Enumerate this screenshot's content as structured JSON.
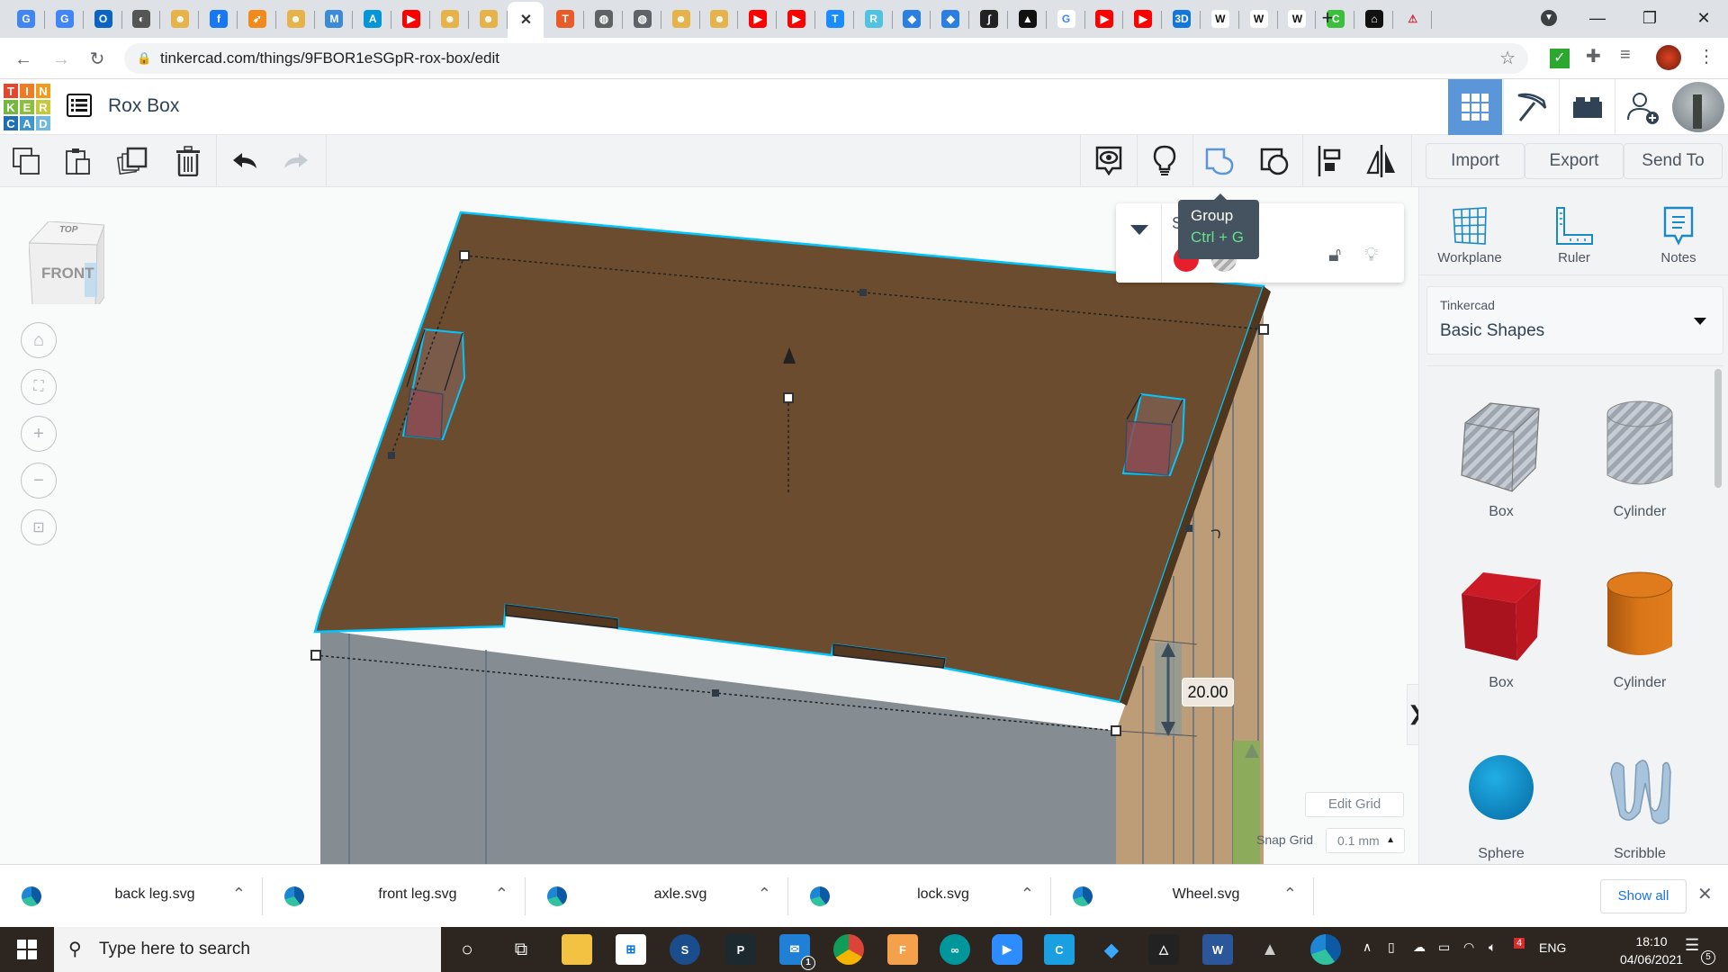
{
  "browser": {
    "tabs": [
      {
        "icon": "google-translate-icon",
        "color": "#4285f4",
        "glyph": "G"
      },
      {
        "icon": "google-translate-icon",
        "color": "#4285f4",
        "glyph": "G"
      },
      {
        "icon": "outlook-icon",
        "color": "#0a64c2",
        "glyph": "O"
      },
      {
        "icon": "app-icon",
        "color": "#555",
        "glyph": "◐"
      },
      {
        "icon": "tinkercad-bot-icon",
        "color": "#e6b34a",
        "glyph": "☻"
      },
      {
        "icon": "facebook-icon",
        "color": "#1877f2",
        "glyph": "f"
      },
      {
        "icon": "arrow-app-icon",
        "color": "#f08a1c",
        "glyph": "➶"
      },
      {
        "icon": "tinkercad-bot-icon",
        "color": "#e6b34a",
        "glyph": "☻"
      },
      {
        "icon": "hex-app-icon",
        "color": "#3b8bd8",
        "glyph": "M"
      },
      {
        "icon": "autodesk-icon",
        "color": "#0696d7",
        "glyph": "A"
      },
      {
        "icon": "youtube-icon",
        "color": "#ff0000",
        "glyph": "▶"
      },
      {
        "icon": "tinkercad-bot-icon",
        "color": "#e6b34a",
        "glyph": "☻"
      },
      {
        "icon": "tinkercad-bot-icon",
        "color": "#e6b34a",
        "glyph": "☻"
      },
      {
        "icon": "close-icon",
        "active": true,
        "glyph": "✕"
      },
      {
        "icon": "tinkercad-icon",
        "color": "#e95c2a",
        "glyph": "T"
      },
      {
        "icon": "globe-icon",
        "color": "#5f6368",
        "glyph": "◍"
      },
      {
        "icon": "globe-icon",
        "color": "#5f6368",
        "glyph": "◍"
      },
      {
        "icon": "tinkercad-bot-icon",
        "color": "#e6b34a",
        "glyph": "☻"
      },
      {
        "icon": "tinkercad-bot-icon",
        "color": "#e6b34a",
        "glyph": "☻"
      },
      {
        "icon": "youtube-icon",
        "color": "#ff0000",
        "glyph": "▶"
      },
      {
        "icon": "youtube-icon",
        "color": "#ff0000",
        "glyph": "▶"
      },
      {
        "icon": "t-app-icon",
        "color": "#1a8cff",
        "glyph": "T"
      },
      {
        "icon": "robot-icon",
        "color": "#4fc3e0",
        "glyph": "R"
      },
      {
        "icon": "book-icon",
        "color": "#2b7fe0",
        "glyph": "◆"
      },
      {
        "icon": "book-icon",
        "color": "#2b7fe0",
        "glyph": "◆"
      },
      {
        "icon": "integral-icon",
        "color": "#222",
        "glyph": "∫"
      },
      {
        "icon": "inkscape-icon",
        "color": "#111",
        "glyph": "▲"
      },
      {
        "icon": "google-icon",
        "color": "#ffffff",
        "glyph": "G"
      },
      {
        "icon": "youtube-icon",
        "color": "#ff0000",
        "glyph": "▶"
      },
      {
        "icon": "youtube-icon",
        "color": "#ff0000",
        "glyph": "▶"
      },
      {
        "icon": "3d-app-icon",
        "color": "#1177dd",
        "glyph": "3D"
      },
      {
        "icon": "wikipedia-icon",
        "color": "#ffffff",
        "glyph": "W"
      },
      {
        "icon": "wikipedia-icon",
        "color": "#ffffff",
        "glyph": "W"
      },
      {
        "icon": "wikipedia-icon",
        "color": "#ffffff",
        "glyph": "W"
      },
      {
        "icon": "c-app-icon",
        "color": "#3cbf3c",
        "glyph": "C"
      },
      {
        "icon": "museum-icon",
        "color": "#111",
        "glyph": "⌂"
      },
      {
        "icon": "warning-app-icon",
        "color": "#dee1e6",
        "glyph": "⚠"
      }
    ],
    "new_tab": "+",
    "url": "tinkercad.com/things/9FBOR1eSGpR-rox-box/edit"
  },
  "app": {
    "logo_letters": [
      "T",
      "I",
      "N",
      "K",
      "E",
      "R",
      "C",
      "A",
      "D"
    ],
    "logo_colors": [
      "#e5462d",
      "#f17b22",
      "#f49a1a",
      "#74b83e",
      "#8dbf3c",
      "#c7c93a",
      "#1d6eb5",
      "#3f94d2",
      "#71b9e2"
    ],
    "project_title": "Rox Box"
  },
  "toolbar": {
    "import": "Import",
    "export": "Export",
    "send_to": "Send To"
  },
  "tooltip": {
    "title": "Group",
    "shortcut": "Ctrl + G"
  },
  "inspector": {
    "title": "Shapes(3)",
    "solid_color": "#e81e2d"
  },
  "viewport": {
    "viewcube_top": "TOP",
    "viewcube_front": "FRONT",
    "dimension_value": "20.00",
    "edit_grid": "Edit Grid",
    "snap_grid_label": "Snap Grid",
    "snap_grid_value": "0.1 mm"
  },
  "panel": {
    "tools": [
      "Workplane",
      "Ruler",
      "Notes"
    ],
    "library_source": "Tinkercad",
    "library_name": "Basic Shapes",
    "shapes": [
      {
        "label": "Box",
        "kind": "box-hole"
      },
      {
        "label": "Cylinder",
        "kind": "cylinder-hole"
      },
      {
        "label": "Box",
        "kind": "box"
      },
      {
        "label": "Cylinder",
        "kind": "cylinder"
      },
      {
        "label": "Sphere",
        "kind": "sphere"
      },
      {
        "label": "Scribble",
        "kind": "scribble"
      }
    ]
  },
  "downloads": {
    "items": [
      "back leg.svg",
      "front leg.svg",
      "axle.svg",
      "lock.svg",
      "Wheel.svg"
    ],
    "show_all": "Show all"
  },
  "taskbar": {
    "search_placeholder": "Type here to search",
    "language": "ENG",
    "time": "18:10",
    "date": "04/06/2021",
    "mail_badge": "1",
    "notification_count": "5",
    "tray_badge": "4"
  }
}
